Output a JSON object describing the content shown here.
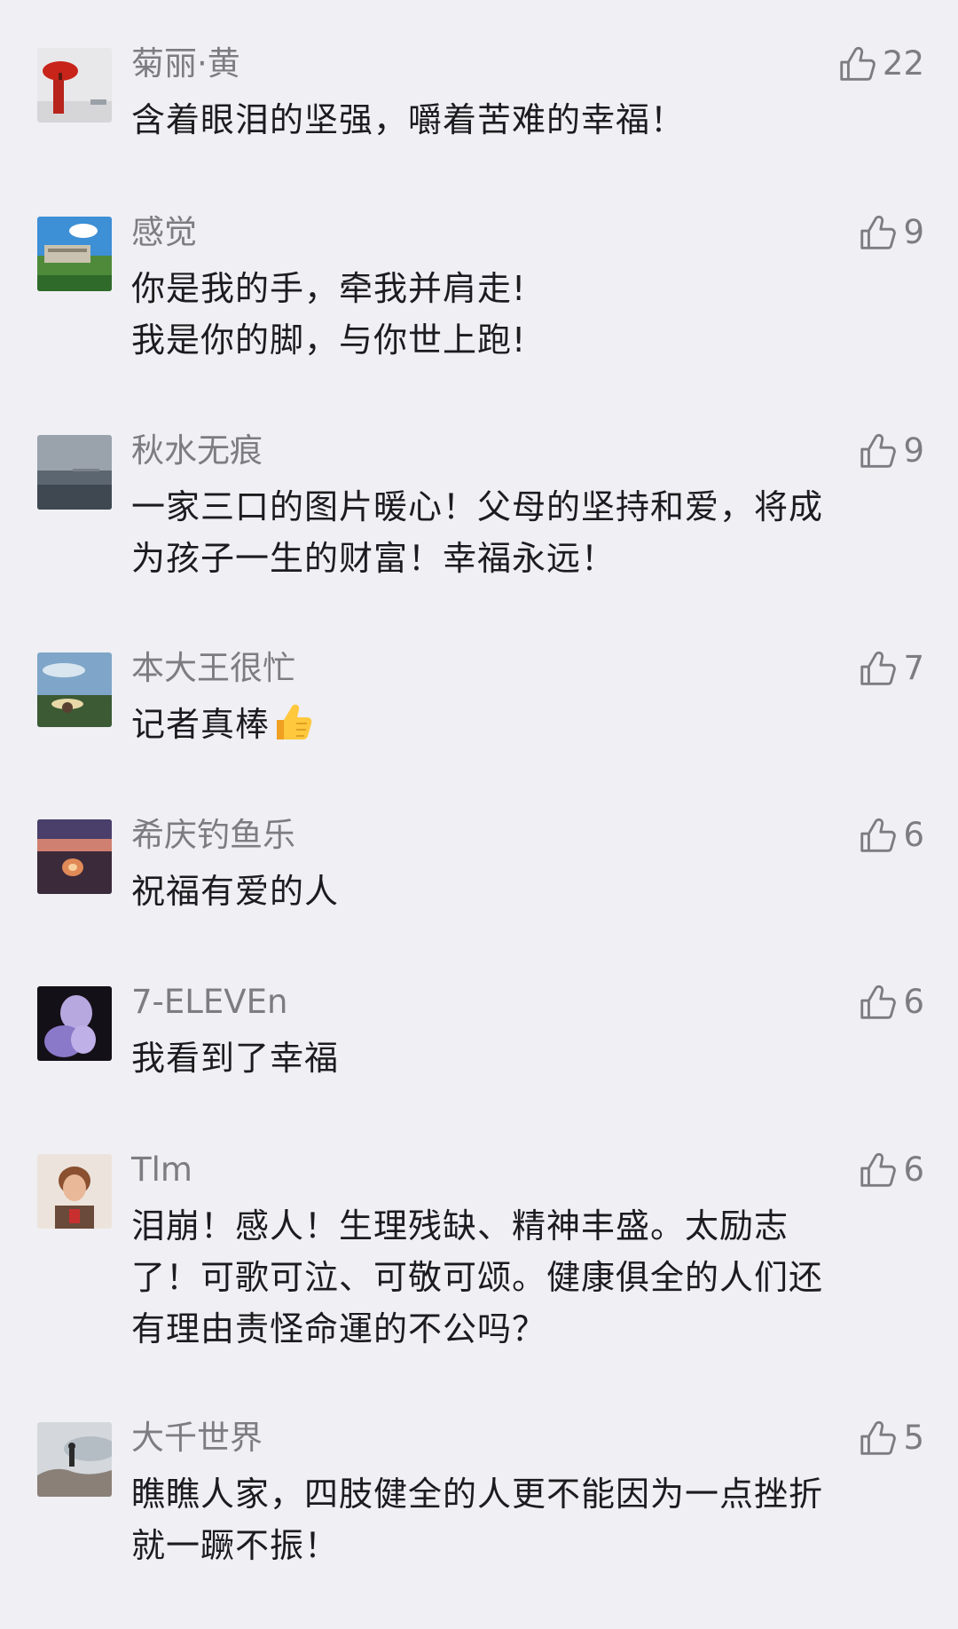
{
  "comments": [
    {
      "username": "菊丽·黄",
      "likes": "22",
      "lines": [
        "含着眼泪的坚强，嚼着苦难的幸福！"
      ],
      "avatar": "red-umbrella-avatar"
    },
    {
      "username": "感觉",
      "likes": "9",
      "lines": [
        "你是我的手，牵我并肩走!",
        "我是你的脚，与你世上跑!"
      ],
      "avatar": "building-sky-avatar"
    },
    {
      "username": "秋水无痕",
      "likes": "9",
      "lines": [
        "一家三口的图片暖心！父母的坚持和爱，将成",
        "为孩子一生的财富！幸福永远！"
      ],
      "avatar": "sea-avatar"
    },
    {
      "username": "本大王很忙",
      "likes": "7",
      "lines": [
        "记者真棒"
      ],
      "emoji": "thumbs-up-emoji",
      "avatar": "hat-landscape-avatar"
    },
    {
      "username": "希庆钓鱼乐",
      "likes": "6",
      "lines": [
        "祝福有爱的人"
      ],
      "avatar": "sunset-beach-avatar"
    },
    {
      "username": "7-ELEVEn",
      "likes": "6",
      "lines": [
        "我看到了幸福"
      ],
      "avatar": "purple-figure-avatar"
    },
    {
      "username": "Tlm",
      "likes": "6",
      "lines": [
        "泪崩！感人！生理残缺、精神丰盛。太励志",
        "了！可歌可泣、可敬可颂。健康俱全的人们还",
        "有理由责怪命運的不公吗？"
      ],
      "avatar": "portrait-avatar"
    },
    {
      "username": "大千世界",
      "likes": "5",
      "lines": [
        "瞧瞧人家，四肢健全的人更不能因为一点挫折",
        "就一蹶不振！"
      ],
      "avatar": "person-rock-avatar"
    }
  ],
  "icons": {
    "like": "thumbs-up-outline-icon"
  },
  "colors": {
    "background": "#efeff4",
    "meta_text": "#7c7c82",
    "body_text": "#1c1c1e"
  }
}
